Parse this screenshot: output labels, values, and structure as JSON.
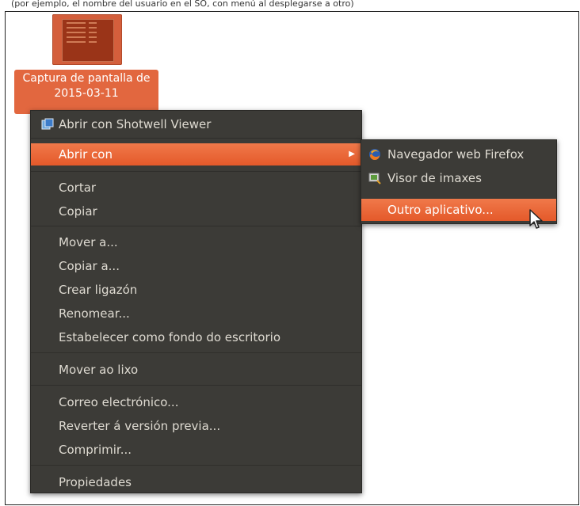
{
  "caption": "(por ejemplo, el nombre del usuario en el SO, con menú al desplegarse a otro)",
  "desktop": {
    "file_label": "Captura de pantalla de 2015-03-11",
    "icon": "image-file-thumbnail-icon"
  },
  "menu": {
    "items": [
      {
        "label": "Abrir con Shotwell Viewer",
        "icon": "shotwell-icon"
      },
      {
        "label": "Abrir con",
        "icon": "chevron-right-icon",
        "highlighted": true
      },
      {
        "label": "Cortar"
      },
      {
        "label": "Copiar"
      },
      {
        "label": "Mover a..."
      },
      {
        "label": "Copiar a..."
      },
      {
        "label": "Crear ligazón"
      },
      {
        "label": "Renomear..."
      },
      {
        "label": "Estabelecer como fondo do escritorio"
      },
      {
        "label": "Mover ao lixo"
      },
      {
        "label": "Correo electrónico..."
      },
      {
        "label": "Reverter á versión previa..."
      },
      {
        "label": "Comprimir..."
      },
      {
        "label": "Propiedades"
      }
    ]
  },
  "submenu": {
    "items": [
      {
        "label": "Navegador web Firefox",
        "icon": "firefox-icon"
      },
      {
        "label": "Visor de imaxes",
        "icon": "image-viewer-icon"
      },
      {
        "label": "Outro aplicativo...",
        "highlighted": true
      }
    ]
  },
  "colors": {
    "accent": "#e4592a",
    "menu_bg": "#3c3b37",
    "menu_text": "#dfdbd2"
  }
}
